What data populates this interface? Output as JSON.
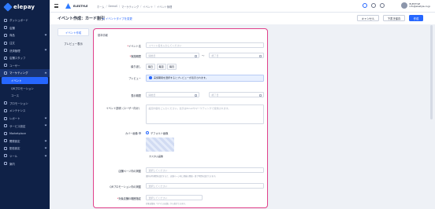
{
  "app": {
    "brand": "elepay"
  },
  "sidebar": {
    "items": [
      {
        "label": "ダッシュボード",
        "icon": "home-icon"
      },
      {
        "label": "店舗",
        "icon": "store-icon"
      },
      {
        "label": "商品",
        "icon": "tag-icon"
      },
      {
        "label": "注文",
        "icon": "cart-icon"
      },
      {
        "label": "決済管理",
        "icon": "card-icon"
      },
      {
        "label": "店舗スタッフ",
        "icon": "staff-icon"
      },
      {
        "label": "ユーザー",
        "icon": "user-icon"
      },
      {
        "label": "マーケティング",
        "icon": "megaphone-icon",
        "badge": "NEW"
      }
    ],
    "sub_items": [
      "イベント",
      "QRプロモーション",
      "コース"
    ],
    "lower_items": [
      {
        "label": "プロモーション",
        "icon": "gift-icon"
      },
      {
        "label": "メンテナンス",
        "icon": "wrench-icon"
      },
      {
        "label": "レポート",
        "icon": "chart-icon"
      },
      {
        "label": "サービス設定",
        "icon": "settings-icon"
      },
      {
        "label": "Marketplace",
        "icon": "grid-icon"
      },
      {
        "label": "開発設定",
        "icon": "code-icon"
      },
      {
        "label": "配信設定",
        "icon": "send-icon"
      },
      {
        "label": "ツール",
        "icon": "tool-icon"
      },
      {
        "label": "案内",
        "icon": "info-icon"
      }
    ]
  },
  "topbar": {
    "store_name": "ELESTYLE",
    "breadcrumbs": [
      "ホーム",
      "DemoS",
      "マーケティング",
      "イベント",
      "イベント管理"
    ],
    "user_name": "ELESTYLE",
    "user_email": "info@elestyle.co.jp"
  },
  "header": {
    "title": "イベント作成：カード割引",
    "change_link": "⇄ イベントタイプを変更",
    "cancel_label": "キャンセル",
    "draft_label": "下書き保存",
    "create_label": "作成"
  },
  "tabs": [
    "イベント作成",
    "プレビュー表示"
  ],
  "form": {
    "section": "基本情報",
    "event_name_label": "イベント名",
    "event_name_placeholder": "イベント名を入力してください",
    "period_label": "実施期間",
    "start_placeholder": "開始日",
    "end_placeholder": "終了日",
    "tilde": "〜",
    "repeat_label": "繰り返し",
    "repeat_options": [
      "毎日",
      "毎週",
      "毎月"
    ],
    "preview_label": "プレビュー",
    "preview_info": "実施期間を選択するとプレビューが表示されます。",
    "display_period_label": "表示期間",
    "display_start": "開始日",
    "display_end": "終了日",
    "desc_label": "イベント説明（ユーザー向け）",
    "desc_placeholder": "設定内容をご入力ください。表示はEmailやマーケティングで使用されます。",
    "cover_label": "カバー画像",
    "cover_default": "デフォルト画像",
    "cover_custom": "カスタム画像",
    "target_label": "店舗ページ内の掲載",
    "target_placeholder": "選択してください",
    "target_help": "選択の時期間を設定すると、店舗ページ内に掲載の開始・終了時間を設定できます。",
    "qr_label": "QRプロモーション内の掲載",
    "qr_placeholder": "選択してください",
    "store_label": "対象店舗の範囲指定",
    "store_placeholder": "選択してください",
    "store_help": "対象店舗を「すべての店舗」から指定できます。"
  }
}
